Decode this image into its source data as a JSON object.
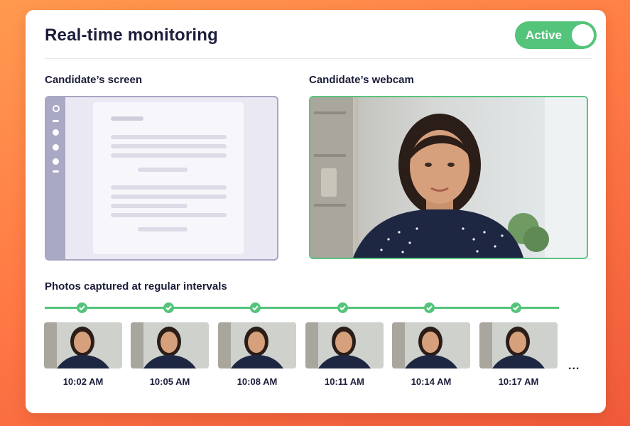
{
  "header": {
    "title": "Real-time monitoring",
    "status_toggle": {
      "label": "Active",
      "state": "on"
    }
  },
  "screen_panel": {
    "label": "Candidate’s screen"
  },
  "webcam_panel": {
    "label": "Candidate’s webcam"
  },
  "captures": {
    "label": "Photos captured at regular intervals",
    "items": [
      {
        "time": "10:02 AM"
      },
      {
        "time": "10:05 AM"
      },
      {
        "time": "10:08 AM"
      },
      {
        "time": "10:11 AM"
      },
      {
        "time": "10:14 AM"
      },
      {
        "time": "10:17 AM"
      }
    ],
    "more": "..."
  },
  "colors": {
    "accent_green": "#54c47b",
    "title_navy": "#1b1d3a",
    "screen_purple": "#a9a8c5",
    "background_orange": "#ff7a45"
  }
}
